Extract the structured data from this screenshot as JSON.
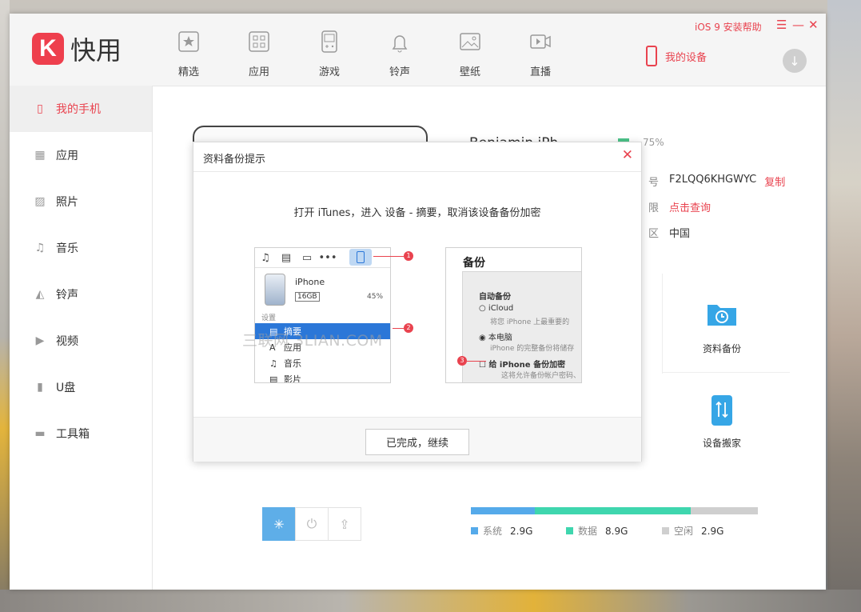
{
  "app": {
    "logo_mark": "K",
    "logo_text": "快用"
  },
  "header": {
    "nav": [
      {
        "label": "精选",
        "icon": "star-icon"
      },
      {
        "label": "应用",
        "icon": "grid-icon"
      },
      {
        "label": "游戏",
        "icon": "gamepad-icon"
      },
      {
        "label": "铃声",
        "icon": "bell-icon"
      },
      {
        "label": "壁纸",
        "icon": "wallpaper-icon"
      },
      {
        "label": "直播",
        "icon": "video-icon"
      }
    ],
    "my_device": "我的设备",
    "ios_help": "iOS 9 安装帮助",
    "window_controls": {
      "menu": "☰",
      "minimize": "—",
      "close": "✕"
    },
    "download_glyph": "↓"
  },
  "sidebar": {
    "items": [
      {
        "label": "我的手机",
        "icon": "phone-icon",
        "glyph": "▯",
        "active": true
      },
      {
        "label": "应用",
        "icon": "apps-icon",
        "glyph": "▦"
      },
      {
        "label": "照片",
        "icon": "photo-icon",
        "glyph": "▨"
      },
      {
        "label": "音乐",
        "icon": "music-icon",
        "glyph": "♫"
      },
      {
        "label": "铃声",
        "icon": "bell-icon",
        "glyph": "◭"
      },
      {
        "label": "视频",
        "icon": "play-icon",
        "glyph": "▶"
      },
      {
        "label": "U盘",
        "icon": "usb-icon",
        "glyph": "▮"
      },
      {
        "label": "工具箱",
        "icon": "toolbox-icon",
        "glyph": "▬"
      }
    ]
  },
  "device": {
    "name": "Benjamin iPh...",
    "battery": "75%",
    "info": [
      {
        "key": "号",
        "value": "F2LQQ6KHGWYC",
        "action": "复制"
      },
      {
        "key": "限",
        "value": "",
        "action": "点击查询"
      },
      {
        "key": "区",
        "value": "中国",
        "action": ""
      }
    ],
    "tools": [
      {
        "label": "资料备份"
      },
      {
        "label": "设备搬家"
      }
    ],
    "storage": {
      "system": {
        "label": "系统",
        "value": "2.9G",
        "fraction": 0.22
      },
      "data": {
        "label": "数据",
        "value": "8.9G",
        "fraction": 0.54
      },
      "free": {
        "label": "空闲",
        "value": "2.9G",
        "fraction": 0.24
      }
    },
    "action_buttons": [
      "clean-button",
      "power-button",
      "share-button"
    ]
  },
  "dialog": {
    "title": "资料备份提示",
    "close_glyph": "✕",
    "instruction": "打开 iTunes，进入 设备 - 摘要，取消该设备备份加密",
    "itunes": {
      "toolbar": [
        "♫",
        "▤",
        "▭",
        "•••"
      ],
      "device_name": "iPhone",
      "capacity": "16GB",
      "battery": "45%",
      "section": "设置",
      "rows": [
        {
          "label": "摘要",
          "glyph": "▤",
          "selected": true
        },
        {
          "label": "应用",
          "glyph": "A"
        },
        {
          "label": "音乐",
          "glyph": "♫"
        },
        {
          "label": "影片",
          "glyph": "▤"
        }
      ]
    },
    "backup": {
      "title": "备份",
      "auto_label": "自动备份",
      "icloud": "iCloud",
      "icloud_desc": "将您 iPhone 上最重要的",
      "local": "本电脑",
      "local_desc": "iPhone 的完整备份将储存",
      "encrypt": "给 iPhone 备份加密",
      "encrypt_desc": "这将允许备份帐户密码、"
    },
    "steps": [
      "1",
      "2",
      "3"
    ],
    "confirm": "已完成，继续"
  },
  "watermark": "三联网 3LIAN.COM"
}
